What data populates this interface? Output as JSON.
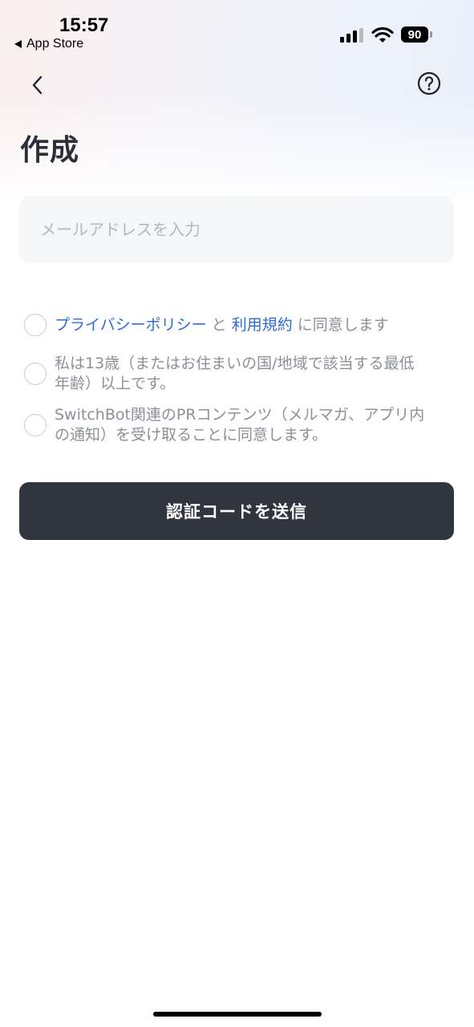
{
  "status_bar": {
    "time": "15:57",
    "back_app": "App Store",
    "battery": "90"
  },
  "header": {
    "title": "作成"
  },
  "form": {
    "email_placeholder": "メールアドレスを入力",
    "agreements": {
      "privacy": {
        "link1": "プライバシーポリシー",
        "connector": " と ",
        "link2": "利用規約",
        "suffix": " に同意します"
      },
      "age_line1": "私は13歳（またはお住まいの国/地域で該当する最低",
      "age_line2": "年齢）以上です。",
      "marketing_line1": "SwitchBot関連のPRコンテンツ（メルマガ、アプリ内",
      "marketing_line2": "の通知）を受け取ることに同意します。"
    },
    "submit_label": "認証コードを送信"
  },
  "icons": {
    "back": "chevron-left-icon",
    "help": "question-circle-icon",
    "signal": "cellular-signal-icon",
    "wifi": "wifi-icon"
  },
  "colors": {
    "link": "#2f6bd8",
    "button_bg": "#31353f",
    "title": "#2b2f3a"
  }
}
